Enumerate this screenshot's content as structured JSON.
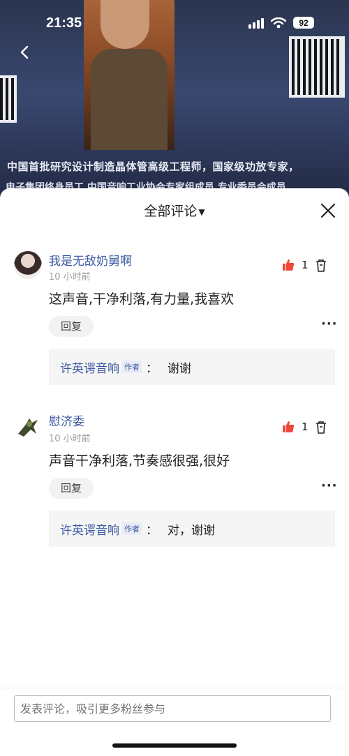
{
  "status_bar": {
    "time": "21:35",
    "battery": "92"
  },
  "video": {
    "caption_line1": "中国首批研究设计制造晶体管高级工程师，国家级功放专家，",
    "caption_line2": "电子集团终身员工   中国音响工业协会专家组成员   专业委员会成员"
  },
  "sheet": {
    "title": "全部评论",
    "comments": [
      {
        "username": "我是无敌奶舅啊",
        "time": "10 小时前",
        "content": "这声音,干净利落,有力量,我喜欢",
        "likes": "1",
        "reply_label": "回复",
        "author_reply": {
          "name": "许英谔音响",
          "badge": "作者",
          "colon": "：",
          "text": "谢谢"
        }
      },
      {
        "username": "慰济委",
        "time": "10 小时前",
        "content": "声音干净利落,节奏感很强,很好",
        "likes": "1",
        "reply_label": "回复",
        "author_reply": {
          "name": "许英谔音响",
          "badge": "作者",
          "colon": "：",
          "text": "对，谢谢"
        }
      }
    ]
  },
  "input": {
    "placeholder": "发表评论，吸引更多粉丝参与"
  },
  "colors": {
    "accent_blue": "#3b5aa3",
    "like_red": "#f0473a"
  },
  "icons": [
    "back-arrow-icon",
    "close-icon",
    "thumbs-up-icon",
    "trash-icon",
    "more-dots-icon",
    "wifi-icon",
    "signal-icon",
    "battery-icon"
  ]
}
